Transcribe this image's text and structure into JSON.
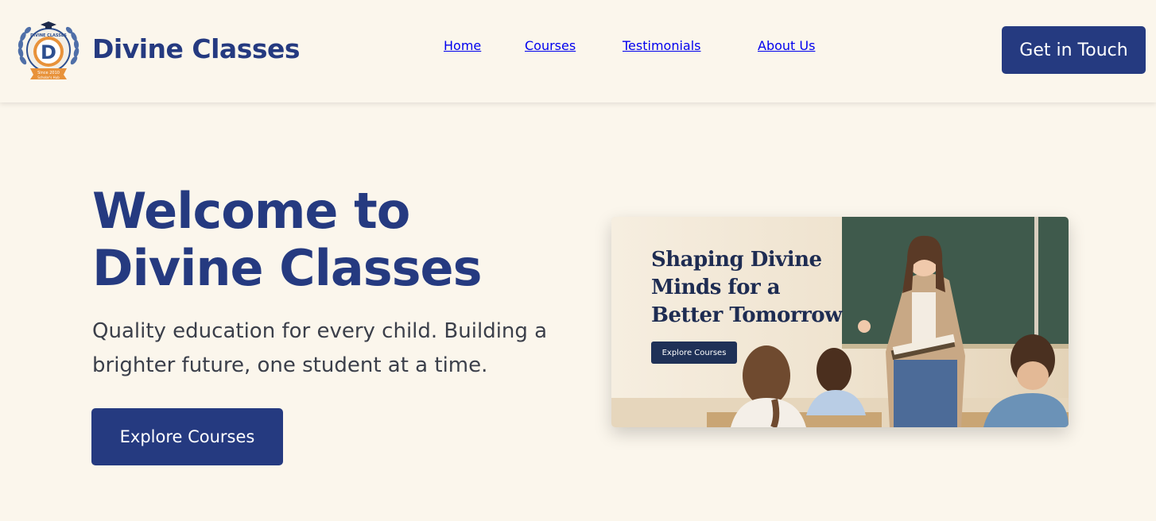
{
  "brand": {
    "name": "Divine Classes",
    "logo_top_text": "DIVINE CLASSES",
    "logo_letter": "D",
    "logo_ribbon_text": "Since 2010",
    "logo_bottom_text": "Scholar's Hub"
  },
  "nav": {
    "items": [
      {
        "label": "Home"
      },
      {
        "label": "Courses"
      },
      {
        "label": "Testimonials"
      },
      {
        "label": "About Us"
      }
    ]
  },
  "header": {
    "cta_label": "Get in Touch"
  },
  "hero": {
    "title_line1": "Welcome to",
    "title_line2": "Divine Classes",
    "subtitle": "Quality education for every child. Building a brighter future, one student at a time.",
    "button_label": "Explore Courses"
  },
  "banner": {
    "title_line1": "Shaping Divine",
    "title_line2": "Minds for a",
    "title_line3": "Better Tomorrow",
    "button_label": "Explore Courses"
  },
  "colors": {
    "page_background": "#fbf6ec",
    "brand_navy": "#253a80",
    "body_text": "#3b3f4a",
    "button_text": "#ffffff"
  }
}
